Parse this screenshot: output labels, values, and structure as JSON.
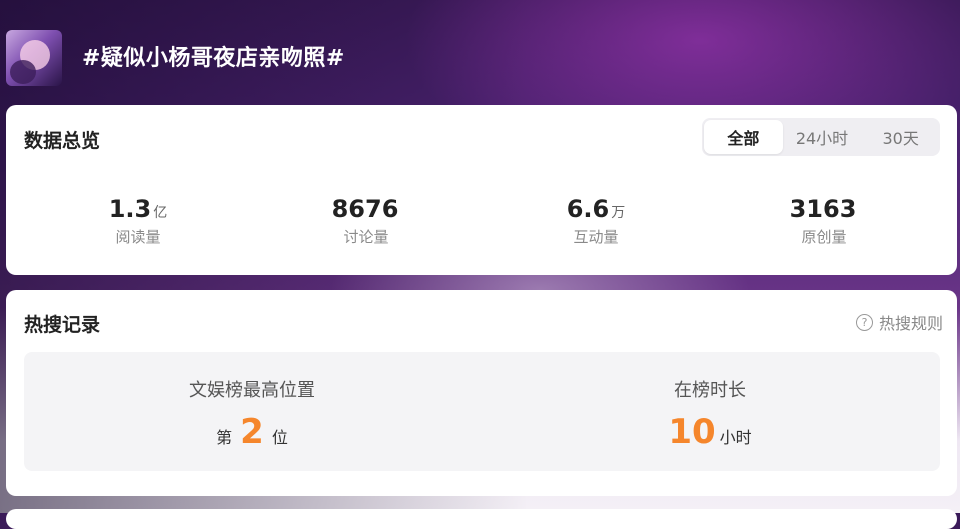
{
  "topic": {
    "title": "#疑似小杨哥夜店亲吻照#"
  },
  "overview": {
    "title": "数据总览",
    "tabs": [
      {
        "label": "全部",
        "active": true
      },
      {
        "label": "24小时",
        "active": false
      },
      {
        "label": "30天",
        "active": false
      }
    ],
    "stats": [
      {
        "value": "1.3",
        "unit": "亿",
        "label": "阅读量"
      },
      {
        "value": "8676",
        "unit": "",
        "label": "讨论量"
      },
      {
        "value": "6.6",
        "unit": "万",
        "label": "互动量"
      },
      {
        "value": "3163",
        "unit": "",
        "label": "原创量"
      }
    ]
  },
  "hot_search": {
    "title": "热搜记录",
    "rules_label": "热搜规则",
    "rules_icon": "question-circle-icon",
    "highest_position": {
      "label": "文娱榜最高位置",
      "prefix": "第",
      "value": "2",
      "suffix": "位"
    },
    "duration": {
      "label": "在榜时长",
      "value": "10",
      "unit": "小时"
    }
  },
  "colors": {
    "accent_orange": "#f5862c",
    "header_purple": "#4b2371"
  }
}
